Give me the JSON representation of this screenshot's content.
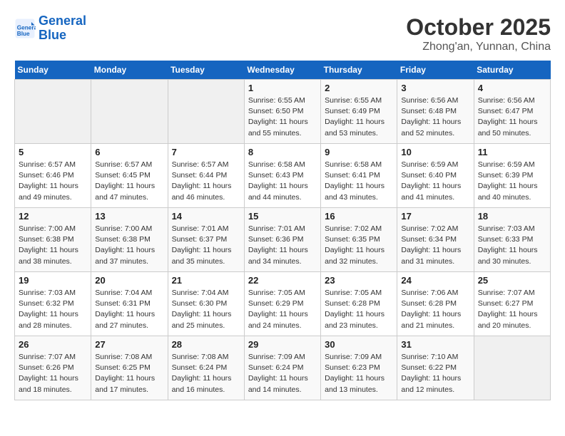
{
  "header": {
    "logo_line1": "General",
    "logo_line2": "Blue",
    "title": "October 2025",
    "subtitle": "Zhong'an, Yunnan, China"
  },
  "weekdays": [
    "Sunday",
    "Monday",
    "Tuesday",
    "Wednesday",
    "Thursday",
    "Friday",
    "Saturday"
  ],
  "weeks": [
    [
      {
        "day": "",
        "info": ""
      },
      {
        "day": "",
        "info": ""
      },
      {
        "day": "",
        "info": ""
      },
      {
        "day": "1",
        "info": "Sunrise: 6:55 AM\nSunset: 6:50 PM\nDaylight: 11 hours and 55 minutes."
      },
      {
        "day": "2",
        "info": "Sunrise: 6:55 AM\nSunset: 6:49 PM\nDaylight: 11 hours and 53 minutes."
      },
      {
        "day": "3",
        "info": "Sunrise: 6:56 AM\nSunset: 6:48 PM\nDaylight: 11 hours and 52 minutes."
      },
      {
        "day": "4",
        "info": "Sunrise: 6:56 AM\nSunset: 6:47 PM\nDaylight: 11 hours and 50 minutes."
      }
    ],
    [
      {
        "day": "5",
        "info": "Sunrise: 6:57 AM\nSunset: 6:46 PM\nDaylight: 11 hours and 49 minutes."
      },
      {
        "day": "6",
        "info": "Sunrise: 6:57 AM\nSunset: 6:45 PM\nDaylight: 11 hours and 47 minutes."
      },
      {
        "day": "7",
        "info": "Sunrise: 6:57 AM\nSunset: 6:44 PM\nDaylight: 11 hours and 46 minutes."
      },
      {
        "day": "8",
        "info": "Sunrise: 6:58 AM\nSunset: 6:43 PM\nDaylight: 11 hours and 44 minutes."
      },
      {
        "day": "9",
        "info": "Sunrise: 6:58 AM\nSunset: 6:41 PM\nDaylight: 11 hours and 43 minutes."
      },
      {
        "day": "10",
        "info": "Sunrise: 6:59 AM\nSunset: 6:40 PM\nDaylight: 11 hours and 41 minutes."
      },
      {
        "day": "11",
        "info": "Sunrise: 6:59 AM\nSunset: 6:39 PM\nDaylight: 11 hours and 40 minutes."
      }
    ],
    [
      {
        "day": "12",
        "info": "Sunrise: 7:00 AM\nSunset: 6:38 PM\nDaylight: 11 hours and 38 minutes."
      },
      {
        "day": "13",
        "info": "Sunrise: 7:00 AM\nSunset: 6:38 PM\nDaylight: 11 hours and 37 minutes."
      },
      {
        "day": "14",
        "info": "Sunrise: 7:01 AM\nSunset: 6:37 PM\nDaylight: 11 hours and 35 minutes."
      },
      {
        "day": "15",
        "info": "Sunrise: 7:01 AM\nSunset: 6:36 PM\nDaylight: 11 hours and 34 minutes."
      },
      {
        "day": "16",
        "info": "Sunrise: 7:02 AM\nSunset: 6:35 PM\nDaylight: 11 hours and 32 minutes."
      },
      {
        "day": "17",
        "info": "Sunrise: 7:02 AM\nSunset: 6:34 PM\nDaylight: 11 hours and 31 minutes."
      },
      {
        "day": "18",
        "info": "Sunrise: 7:03 AM\nSunset: 6:33 PM\nDaylight: 11 hours and 30 minutes."
      }
    ],
    [
      {
        "day": "19",
        "info": "Sunrise: 7:03 AM\nSunset: 6:32 PM\nDaylight: 11 hours and 28 minutes."
      },
      {
        "day": "20",
        "info": "Sunrise: 7:04 AM\nSunset: 6:31 PM\nDaylight: 11 hours and 27 minutes."
      },
      {
        "day": "21",
        "info": "Sunrise: 7:04 AM\nSunset: 6:30 PM\nDaylight: 11 hours and 25 minutes."
      },
      {
        "day": "22",
        "info": "Sunrise: 7:05 AM\nSunset: 6:29 PM\nDaylight: 11 hours and 24 minutes."
      },
      {
        "day": "23",
        "info": "Sunrise: 7:05 AM\nSunset: 6:28 PM\nDaylight: 11 hours and 23 minutes."
      },
      {
        "day": "24",
        "info": "Sunrise: 7:06 AM\nSunset: 6:28 PM\nDaylight: 11 hours and 21 minutes."
      },
      {
        "day": "25",
        "info": "Sunrise: 7:07 AM\nSunset: 6:27 PM\nDaylight: 11 hours and 20 minutes."
      }
    ],
    [
      {
        "day": "26",
        "info": "Sunrise: 7:07 AM\nSunset: 6:26 PM\nDaylight: 11 hours and 18 minutes."
      },
      {
        "day": "27",
        "info": "Sunrise: 7:08 AM\nSunset: 6:25 PM\nDaylight: 11 hours and 17 minutes."
      },
      {
        "day": "28",
        "info": "Sunrise: 7:08 AM\nSunset: 6:24 PM\nDaylight: 11 hours and 16 minutes."
      },
      {
        "day": "29",
        "info": "Sunrise: 7:09 AM\nSunset: 6:24 PM\nDaylight: 11 hours and 14 minutes."
      },
      {
        "day": "30",
        "info": "Sunrise: 7:09 AM\nSunset: 6:23 PM\nDaylight: 11 hours and 13 minutes."
      },
      {
        "day": "31",
        "info": "Sunrise: 7:10 AM\nSunset: 6:22 PM\nDaylight: 11 hours and 12 minutes."
      },
      {
        "day": "",
        "info": ""
      }
    ]
  ]
}
